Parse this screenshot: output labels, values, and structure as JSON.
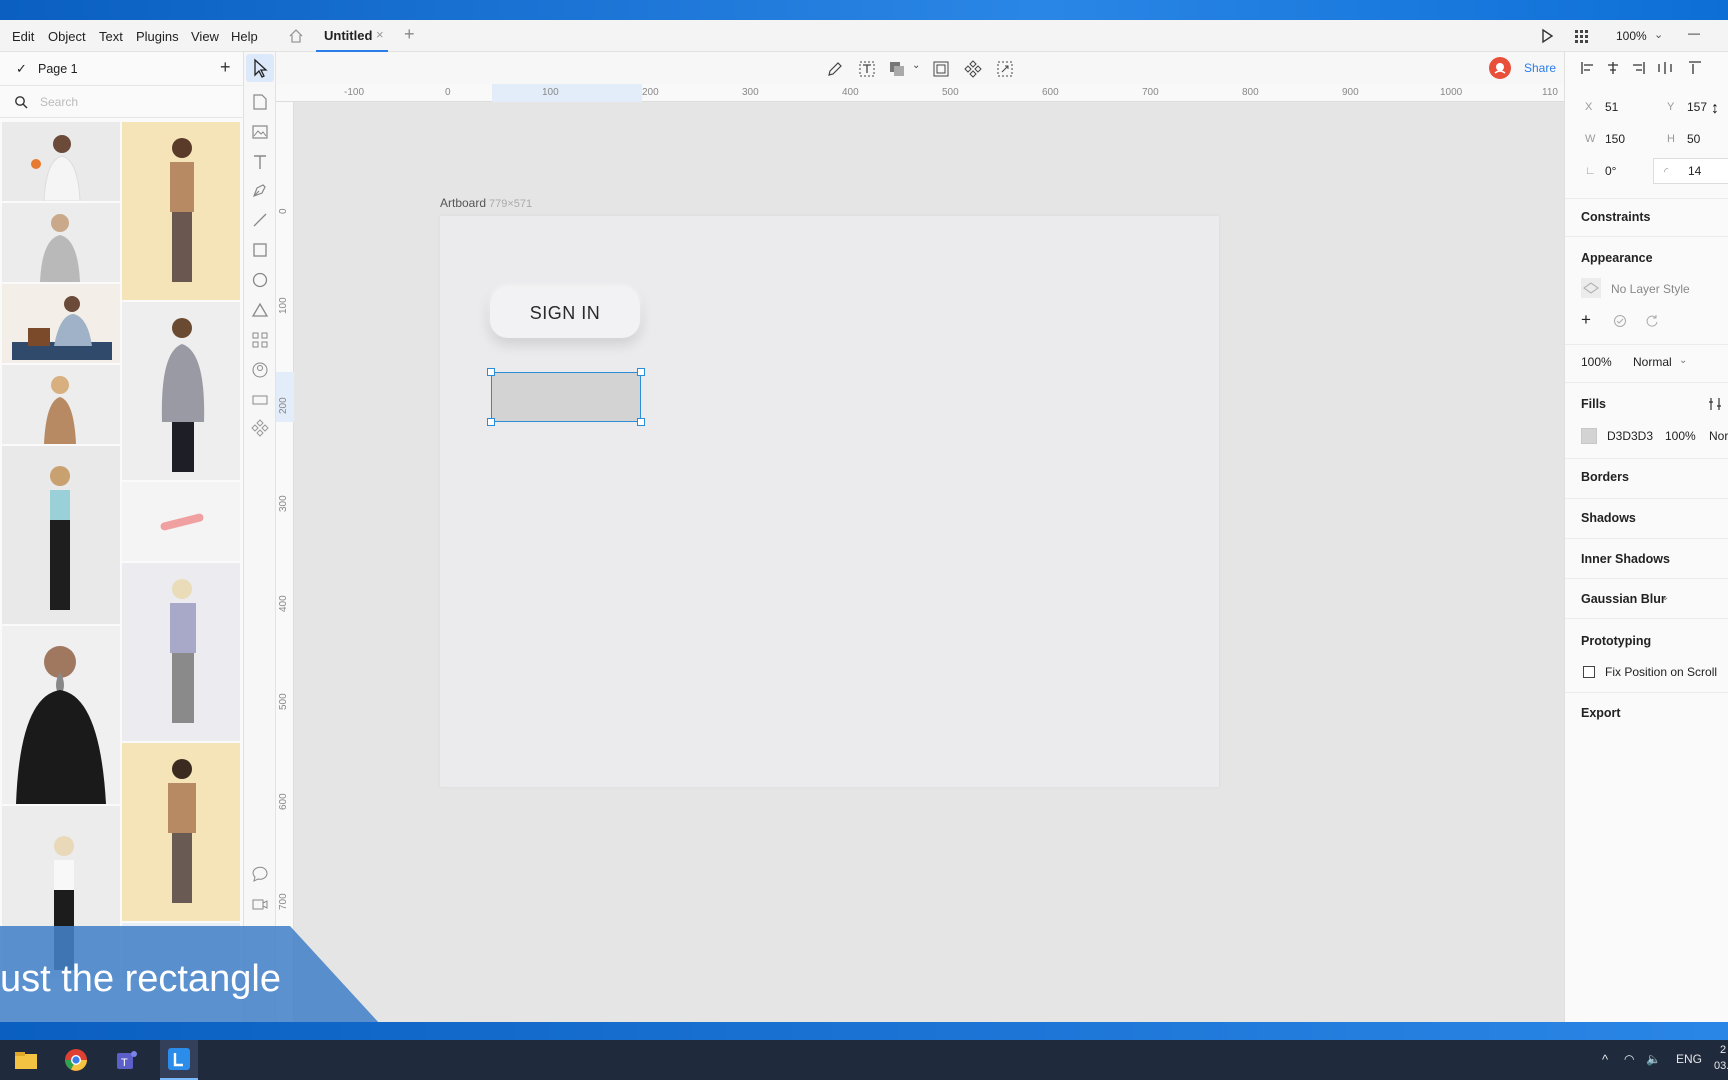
{
  "menu": {
    "items": [
      "Edit",
      "Object",
      "Text",
      "Plugins",
      "View",
      "Help"
    ],
    "tab_title": "Untitled",
    "tab_close": "×",
    "new_tab": "+",
    "zoom": "100%",
    "minimize": "—"
  },
  "toolbar": {
    "share_label": "Share"
  },
  "left_panel": {
    "page_name": "Page 1",
    "add_page": "+",
    "search_placeholder": "Search"
  },
  "rulers": {
    "h_labels": [
      "-100",
      "0",
      "100",
      "200",
      "300",
      "400",
      "500",
      "600",
      "700",
      "800",
      "900",
      "1000",
      "110"
    ],
    "v_labels": [
      "0",
      "100",
      "200",
      "300",
      "400",
      "500",
      "600",
      "700"
    ]
  },
  "canvas": {
    "artboard_name": "Artboard",
    "artboard_size": "779×571",
    "signin_label": "SIGN IN"
  },
  "properties": {
    "x_label": "X",
    "x_value": "51",
    "y_label": "Y",
    "y_value": "157",
    "w_label": "W",
    "w_value": "150",
    "h_label": "H",
    "h_value": "50",
    "rotation": "0°",
    "radius": "14",
    "constraints": "Constraints",
    "appearance": "Appearance",
    "no_layer_style": "No Layer Style",
    "opacity": "100%",
    "blend_mode": "Normal",
    "fills": "Fills",
    "fill_hex": "D3D3D3",
    "fill_opacity": "100%",
    "fill_blend": "Nor",
    "borders": "Borders",
    "shadows": "Shadows",
    "inner_shadows": "Inner Shadows",
    "gaussian_blur": "Gaussian Blur",
    "prototyping": "Prototyping",
    "fix_position": "Fix Position on Scroll",
    "export": "Export"
  },
  "caption": {
    "text": "ust the rectangle"
  },
  "taskbar": {
    "lang": "ENG",
    "clock_top": "2",
    "clock_bottom": "03."
  },
  "colors": {
    "accent": "#2B7DE9",
    "selection": "#2B8DD8",
    "fill": "#D3D3D3",
    "share": "#E8503A"
  }
}
